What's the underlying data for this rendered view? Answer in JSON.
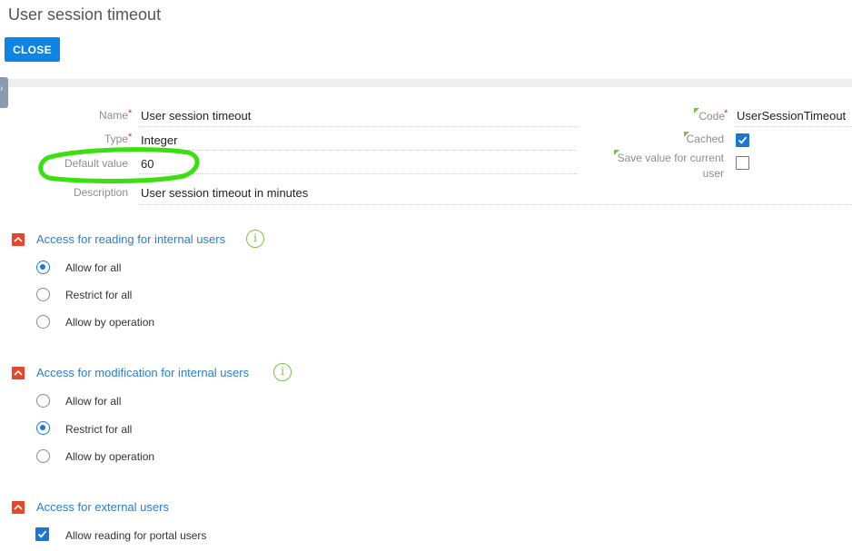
{
  "page": {
    "title": "User session timeout"
  },
  "toolbar": {
    "close_label": "CLOSE"
  },
  "form": {
    "name": {
      "label": "Name",
      "value": "User session timeout"
    },
    "type": {
      "label": "Type",
      "value": "Integer"
    },
    "default_value": {
      "label": "Default value",
      "value": "60"
    },
    "description": {
      "label": "Description",
      "value": "User session timeout in minutes"
    },
    "code": {
      "label": "Code",
      "value": "UserSessionTimeout"
    },
    "cached": {
      "label": "Cached",
      "checked": true
    },
    "save_value": {
      "label_line1": "Save value for current",
      "label_line2": "user",
      "checked": false
    }
  },
  "sections": {
    "reading": {
      "title": "Access for reading for internal users",
      "options": [
        "Allow for all",
        "Restrict for all",
        "Allow by operation"
      ],
      "selected": "Allow for all"
    },
    "modification": {
      "title": "Access for modification for internal users",
      "options": [
        "Allow for all",
        "Restrict for all",
        "Allow by operation"
      ],
      "selected": "Restrict for all"
    },
    "external": {
      "title": "Access for external users",
      "checkbox_label": "Allow reading for portal users",
      "checked": true
    }
  },
  "colors": {
    "accent": "#0e84e5",
    "link": "#2a7ed1",
    "required": "#e0301e",
    "highlight": "#39e00e",
    "section_toggle": "#e8462a"
  }
}
